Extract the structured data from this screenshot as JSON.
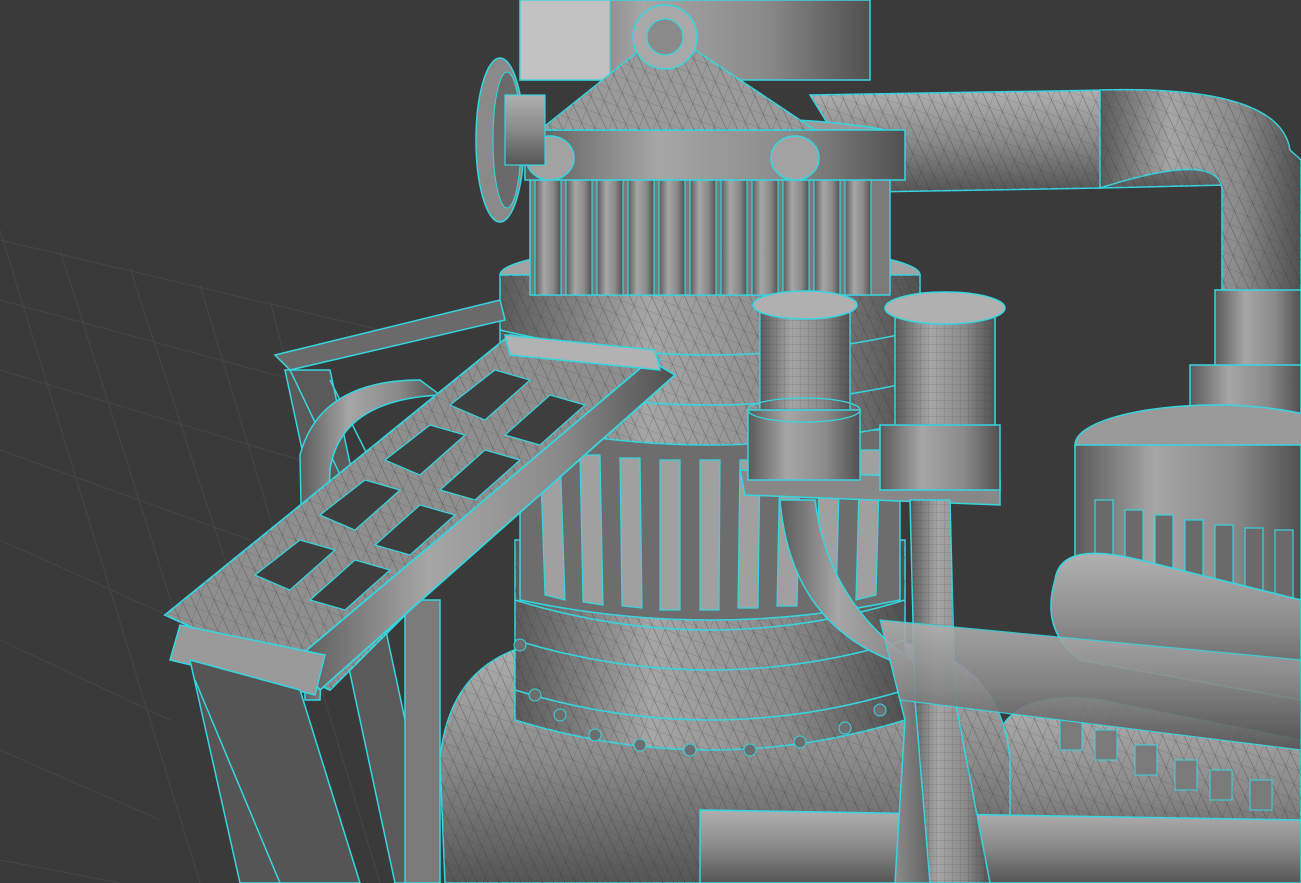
{
  "scene": {
    "background_color": "#3a3a3a",
    "grid_color": "#4a4a4a",
    "mesh_fill": "#8c8c8c",
    "mesh_fill_light": "#a8a8a8",
    "mesh_fill_dark": "#5e5e5e",
    "wire_color": "#2a2a2a",
    "selection_outline_color": "#35d6e0"
  }
}
